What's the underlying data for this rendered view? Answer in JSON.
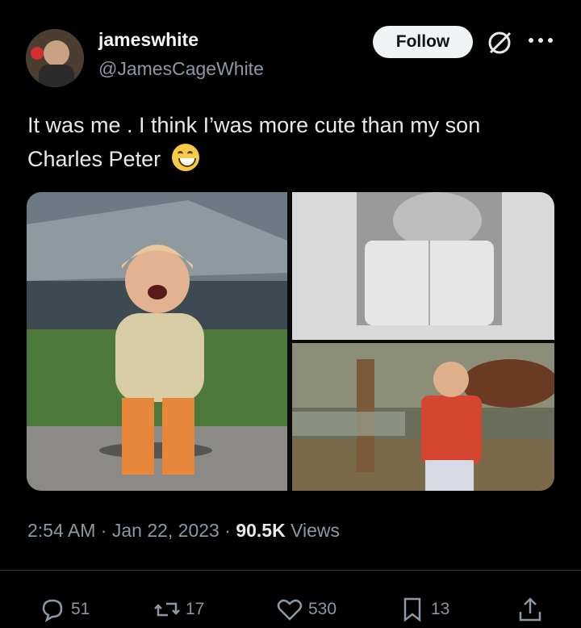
{
  "author": {
    "display_name": "jameswhite",
    "handle": "@JamesCageWhite"
  },
  "header": {
    "follow_label": "Follow"
  },
  "tweet": {
    "text": "It was me . I think I’was more cute than my son Charles Peter",
    "emoji_icon": "grinning-face-emoji"
  },
  "media": {
    "count": 3
  },
  "meta": {
    "time": "2:54 AM",
    "date": "Jan 22, 2023",
    "views_count": "90.5K",
    "views_label": "Views"
  },
  "actions": {
    "replies": "51",
    "reposts": "17",
    "likes": "530",
    "bookmarks": "13"
  },
  "colors": {
    "background": "#000000",
    "text": "#e7e9ea",
    "muted": "#8b98a5",
    "follow_bg": "#eff3f4"
  }
}
